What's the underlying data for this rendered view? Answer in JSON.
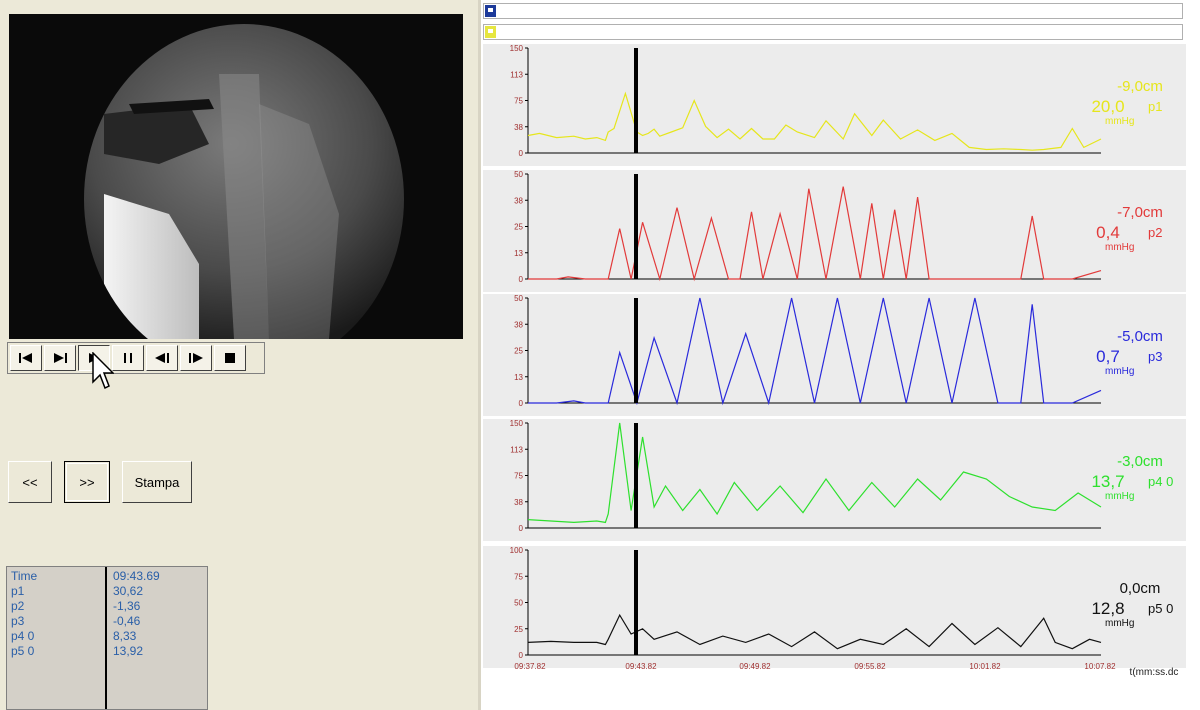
{
  "controls": {
    "icons": [
      "skip-to-start-icon",
      "step-forward-icon",
      "play-icon",
      "pause-icon",
      "step-back-icon",
      "step-frame-forward-icon",
      "stop-icon"
    ]
  },
  "buttons": {
    "prev": "<<",
    "next": ">>",
    "print": "Stampa"
  },
  "readout": [
    {
      "label": "Time",
      "value": "09:43.69"
    },
    {
      "label": "p1",
      "value": "30,62"
    },
    {
      "label": "p2",
      "value": "-1,36"
    },
    {
      "label": "p3",
      "value": "-0,46"
    },
    {
      "label": "p4 0",
      "value": "8,33"
    },
    {
      "label": "p5 0",
      "value": "13,92"
    }
  ],
  "chart_data": [
    {
      "type": "line",
      "name": "p1",
      "color": "#e6e61c",
      "depth": "-9,0cm",
      "value": "20,0",
      "unit": "mmHg",
      "y_ticks": [
        "150",
        "113",
        "75",
        "38",
        "0"
      ],
      "ylim": [
        0,
        150
      ],
      "x": [
        0,
        0.02,
        0.05,
        0.08,
        0.1,
        0.12,
        0.135,
        0.14,
        0.15,
        0.17,
        0.19,
        0.2,
        0.21,
        0.22,
        0.23,
        0.25,
        0.27,
        0.29,
        0.31,
        0.33,
        0.35,
        0.37,
        0.39,
        0.41,
        0.43,
        0.45,
        0.47,
        0.5,
        0.52,
        0.55,
        0.57,
        0.6,
        0.62,
        0.65,
        0.68,
        0.71,
        0.74,
        0.77,
        0.8,
        0.83,
        0.86,
        0.88,
        0.9,
        0.93,
        0.95,
        0.97,
        1.0
      ],
      "y": [
        25,
        28,
        22,
        24,
        20,
        22,
        18,
        30,
        35,
        85,
        30,
        25,
        28,
        34,
        24,
        30,
        36,
        75,
        38,
        22,
        34,
        20,
        35,
        20,
        20,
        40,
        30,
        22,
        46,
        20,
        56,
        25,
        47,
        20,
        33,
        18,
        28,
        8,
        5,
        6,
        5,
        4,
        5,
        8,
        35,
        8,
        20
      ]
    },
    {
      "type": "line",
      "name": "p2",
      "color": "#e23a3a",
      "depth": "-7,0cm",
      "value": "0,4",
      "unit": "mmHg",
      "y_ticks": [
        "50",
        "38",
        "25",
        "13",
        "0"
      ],
      "ylim": [
        0,
        50
      ],
      "x": [
        0,
        0.05,
        0.07,
        0.1,
        0.12,
        0.135,
        0.14,
        0.16,
        0.18,
        0.2,
        0.23,
        0.26,
        0.29,
        0.32,
        0.35,
        0.37,
        0.39,
        0.41,
        0.44,
        0.47,
        0.49,
        0.52,
        0.55,
        0.58,
        0.6,
        0.62,
        0.64,
        0.66,
        0.68,
        0.7,
        0.72,
        0.74,
        0.78,
        0.82,
        0.86,
        0.88,
        0.9,
        0.92,
        0.95,
        1.0
      ],
      "y": [
        0,
        0,
        1,
        0,
        0,
        0,
        0,
        24,
        0,
        27,
        0,
        34,
        0,
        29,
        0,
        0,
        32,
        0,
        31,
        0,
        43,
        0,
        44,
        0,
        36,
        0,
        33,
        0,
        39,
        0,
        0,
        0,
        0,
        0,
        0,
        30,
        0,
        0,
        0,
        4
      ]
    },
    {
      "type": "line",
      "name": "p3",
      "color": "#2a2adb",
      "depth": "-5,0cm",
      "value": "0,7",
      "unit": "mmHg",
      "y_ticks": [
        "50",
        "38",
        "25",
        "13",
        "0"
      ],
      "ylim": [
        0,
        50
      ],
      "x": [
        0,
        0.05,
        0.08,
        0.1,
        0.135,
        0.14,
        0.16,
        0.19,
        0.22,
        0.26,
        0.3,
        0.34,
        0.38,
        0.42,
        0.46,
        0.5,
        0.54,
        0.58,
        0.62,
        0.66,
        0.7,
        0.74,
        0.78,
        0.82,
        0.86,
        0.88,
        0.9,
        0.95,
        1.0
      ],
      "y": [
        0,
        0,
        1,
        0,
        0,
        0,
        24,
        0,
        31,
        0,
        50,
        0,
        33,
        0,
        50,
        0,
        50,
        0,
        50,
        0,
        50,
        0,
        50,
        0,
        0,
        47,
        0,
        0,
        6
      ]
    },
    {
      "type": "line",
      "name": "p4 0",
      "color": "#2ee02e",
      "depth": "-3,0cm",
      "value": "13,7",
      "unit": "mmHg",
      "y_ticks": [
        "150",
        "113",
        "75",
        "38",
        "0"
      ],
      "ylim": [
        0,
        150
      ],
      "x": [
        0,
        0.04,
        0.08,
        0.12,
        0.135,
        0.14,
        0.16,
        0.18,
        0.2,
        0.22,
        0.24,
        0.27,
        0.3,
        0.33,
        0.36,
        0.4,
        0.44,
        0.48,
        0.52,
        0.56,
        0.6,
        0.64,
        0.68,
        0.72,
        0.76,
        0.8,
        0.84,
        0.88,
        0.92,
        0.96,
        1.0
      ],
      "y": [
        12,
        10,
        8,
        10,
        8,
        20,
        150,
        25,
        130,
        30,
        60,
        25,
        55,
        20,
        65,
        25,
        60,
        22,
        70,
        25,
        65,
        30,
        70,
        40,
        80,
        70,
        45,
        30,
        25,
        50,
        30
      ]
    },
    {
      "type": "line",
      "name": "p5 0",
      "color": "#111111",
      "depth": "0,0cm",
      "value": "12,8",
      "unit": "mmHg",
      "y_ticks": [
        "100",
        "75",
        "50",
        "25",
        "0"
      ],
      "ylim": [
        0,
        100
      ],
      "x": [
        0,
        0.04,
        0.08,
        0.12,
        0.135,
        0.14,
        0.16,
        0.18,
        0.2,
        0.22,
        0.26,
        0.3,
        0.34,
        0.38,
        0.42,
        0.46,
        0.5,
        0.54,
        0.58,
        0.62,
        0.66,
        0.7,
        0.74,
        0.78,
        0.82,
        0.86,
        0.9,
        0.92,
        0.95,
        0.98,
        1.0
      ],
      "y": [
        12,
        13,
        12,
        12,
        10,
        15,
        38,
        20,
        25,
        15,
        22,
        10,
        18,
        12,
        20,
        8,
        22,
        6,
        15,
        10,
        25,
        8,
        30,
        10,
        26,
        8,
        35,
        12,
        6,
        15,
        12
      ]
    }
  ],
  "x_axis": {
    "ticks": [
      "09:37.82",
      "09:43.82",
      "09:49.82",
      "09:55.82",
      "10:01.82",
      "10:07.82"
    ],
    "unit": "t(mm:ss.dc"
  }
}
